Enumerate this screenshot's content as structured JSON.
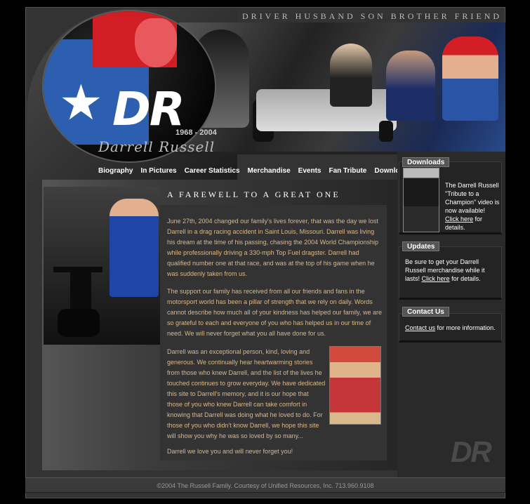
{
  "header": {
    "tagline": "DRIVER  HUSBAND  SON  BROTHER  FRIEND",
    "logo_initials": "DR",
    "logo_years": "1968 - 2004",
    "logo_signature": "Darrell Russell"
  },
  "nav": {
    "items": [
      "Biography",
      "In Pictures",
      "Career Statistics",
      "Merchandise",
      "Events",
      "Fan Tribute",
      "Downloads"
    ]
  },
  "main": {
    "heading": "A FAREWELL TO A GREAT ONE",
    "paragraphs": [
      "June 27th, 2004 changed our family's lives forever, that was the day we lost Darrell in a drag racing accident in Saint Louis, Missouri. Darrell was living his dream at the time of his passing, chasing the 2004 World Championship while professionally driving a 330-mph Top Fuel dragster. Darrell had qualified number one at that race, and was at the top of his game when he was suddenly taken from us.",
      "The support our family has received from all our friends and fans in the motorsport world has been a pillar of strength that we rely on daily. Words cannot describe how much all of your kindness has helped our family, we are so grateful to each and everyone of you who has helped us in our time of need. We will never forget what you all have done for us.",
      "Darrell was an exceptional person, kind, loving and generous. We continually hear heartwarming stories from those who knew Darrell, and the list of the lives he touched continues to grow everyday. We have dedicated this site to Darrell's memory, and it is our hope that those of you who knew Darrell can take comfort in knowing that Darrell was doing what he loved to do. For those of you who didn't know Darrell, we hope this site will show you why he was so loved by so many...",
      "Darrell we love you and will never forget you!"
    ]
  },
  "sidebar": {
    "downloads": {
      "tab": "Downloads",
      "text": "The Darrell Russell \"Tribute to a Champion\" video is now available!",
      "link": "Click here",
      "after_link": "for details."
    },
    "updates": {
      "tab": "Updates",
      "text": "Be sure to get your Darrell Russell merchandise while it lasts!",
      "link": "Click here",
      "after_link": "for details."
    },
    "contact": {
      "tab": "Contact Us",
      "link": "Contact us",
      "after_link": "for more information."
    },
    "watermark": "DR"
  },
  "footer": {
    "text": "©2004 The Russell Family.  Courtesy of Unified Resources, Inc. 713.960.9108"
  }
}
